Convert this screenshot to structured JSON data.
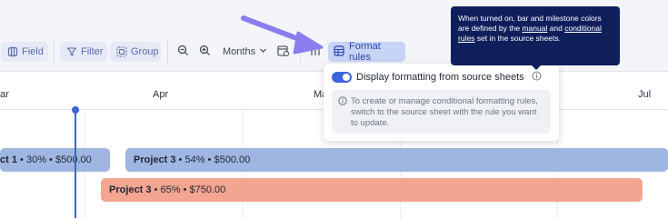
{
  "toolbar": {
    "field_label": "Field",
    "filter_label": "Filter",
    "group_label": "Group",
    "zoom_out_icon": "zoom-out-icon",
    "zoom_in_icon": "zoom-in-icon",
    "scale_label": "Months",
    "format_rules_label": "Format rules"
  },
  "timeline": {
    "months": [
      "ar",
      "Apr",
      "Ma",
      "Jul"
    ],
    "today_marker": true
  },
  "bars": [
    {
      "name": "ct 1",
      "pct": "30%",
      "amount": "$500.00",
      "color": "#9fb6e3"
    },
    {
      "name": "Project 3",
      "pct": "54%",
      "amount": "$500.00",
      "color": "#9fb6e3"
    },
    {
      "name": "Project 3",
      "pct": "65%",
      "amount": "$750.00",
      "color": "#f3a592"
    }
  ],
  "separator": "•",
  "popover": {
    "toggle_label": "Display formatting from source sheets",
    "toggle_on": true,
    "info_text": "To create or manage conditional formatting rules, switch to the source sheet with the rule you want to update."
  },
  "tooltip": {
    "text_1": "When turned on, bar and milestone colors are defined by the ",
    "link_1": "manual",
    "text_2": " and ",
    "link_2": "conditional rules",
    "text_3": " set in the source sheets."
  },
  "colors": {
    "accent": "#3d63dd",
    "tooltip_bg": "#0f1f5c",
    "pointer_arrow": "#8b7cf0"
  }
}
